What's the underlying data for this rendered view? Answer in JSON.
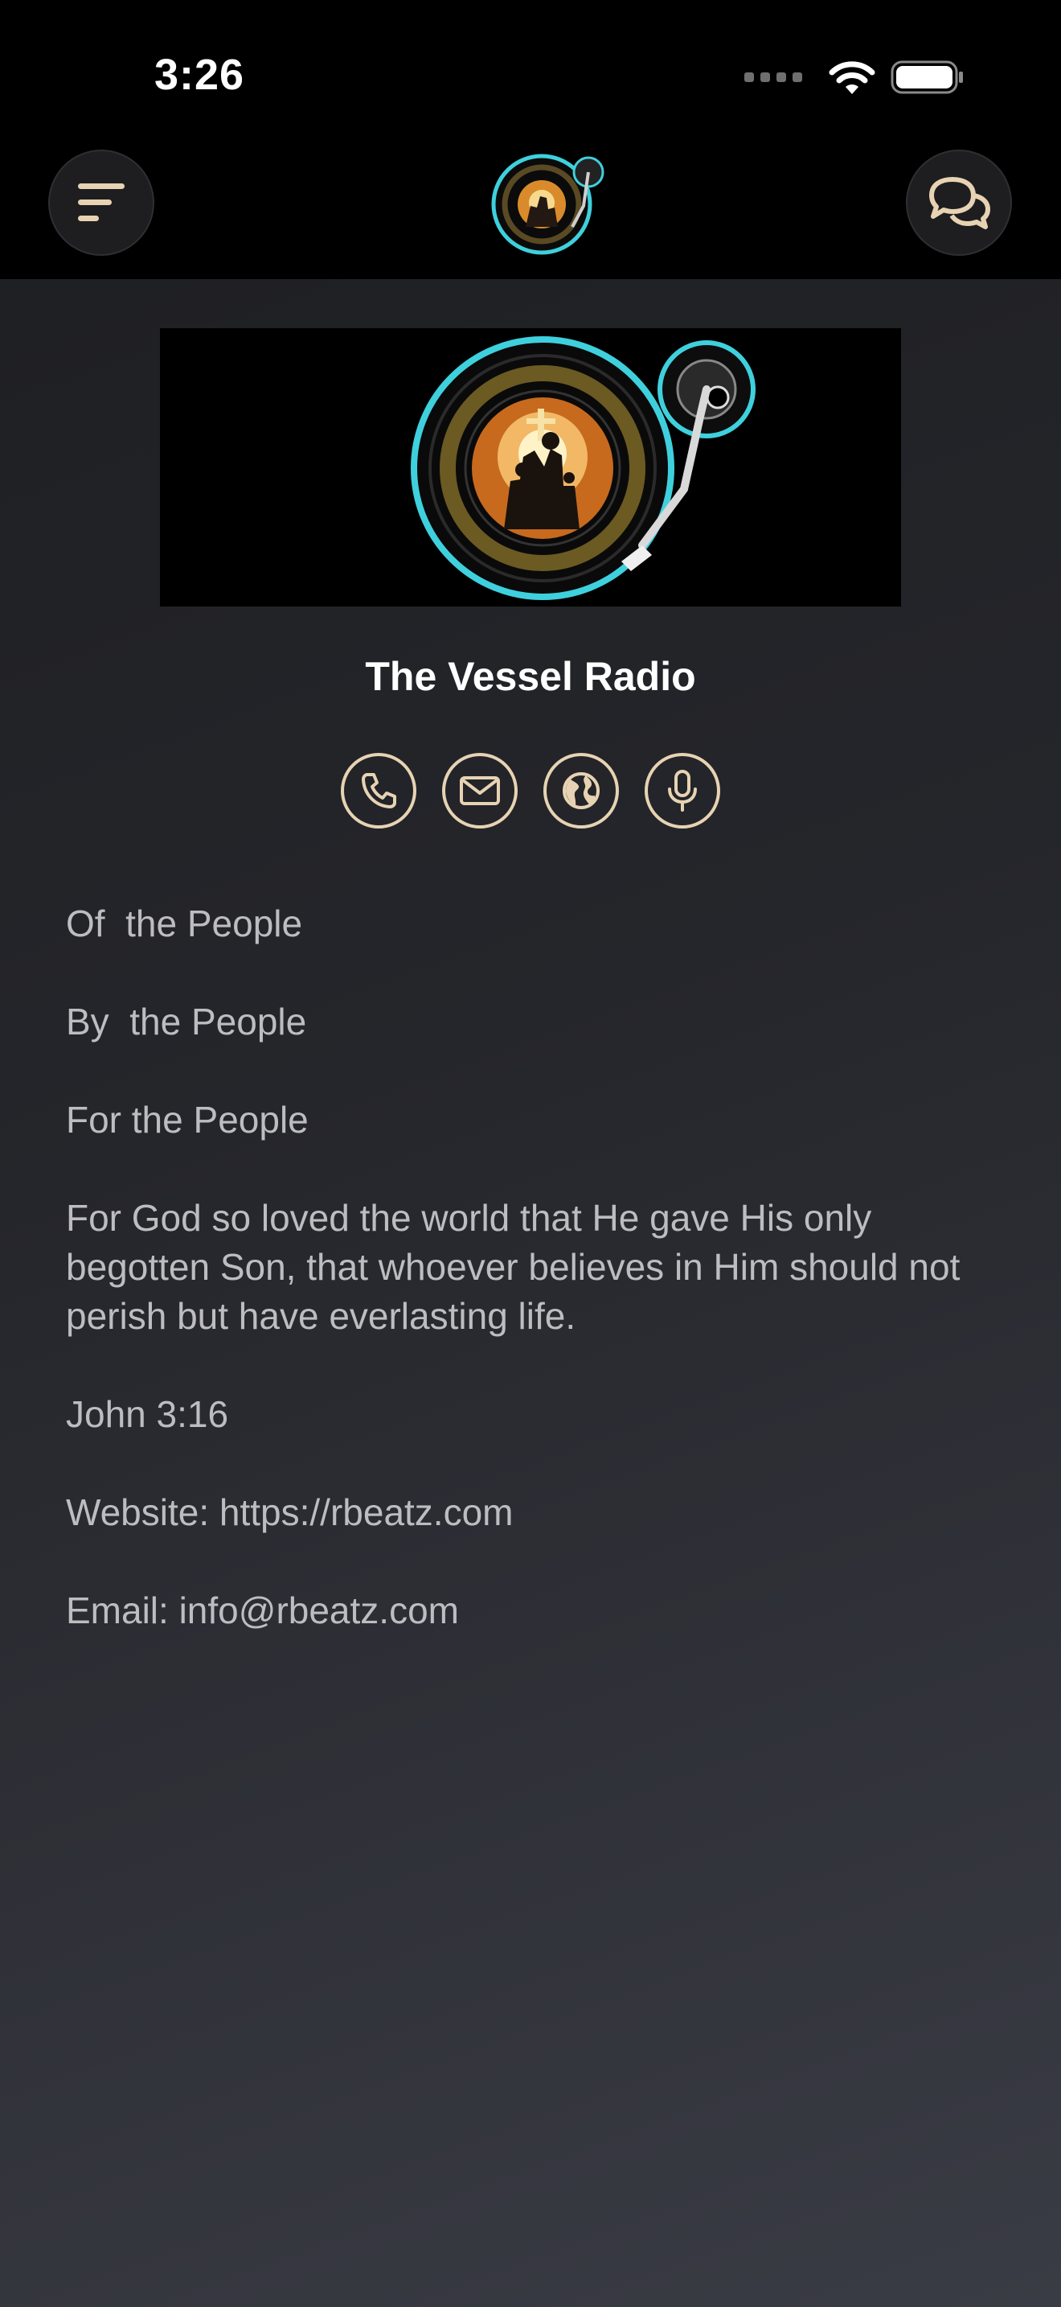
{
  "status_bar": {
    "time": "3:26"
  },
  "header": {
    "menu_icon": "menu-icon",
    "chat_icon": "chat-bubbles-icon",
    "logo": "the-vessel-radio-logo"
  },
  "station": {
    "name": "The Vessel Radio"
  },
  "actions": [
    {
      "icon": "phone-icon"
    },
    {
      "icon": "mail-icon"
    },
    {
      "icon": "globe-icon"
    },
    {
      "icon": "microphone-icon"
    }
  ],
  "description": {
    "lines": [
      "Of  the People",
      "By  the People",
      "For the People",
      "For God so loved the world that He gave His only begotten Son, that whoever believes in Him should not perish but have everlasting life.",
      "John 3:16",
      "Website: https://rbeatz.com",
      "Email: info@rbeatz.com"
    ]
  },
  "colors": {
    "accent": "#e7d3b3",
    "logo_ring": "#3fd0dd",
    "background_top": "#1d1e21",
    "background_bottom": "#3a3c45"
  }
}
